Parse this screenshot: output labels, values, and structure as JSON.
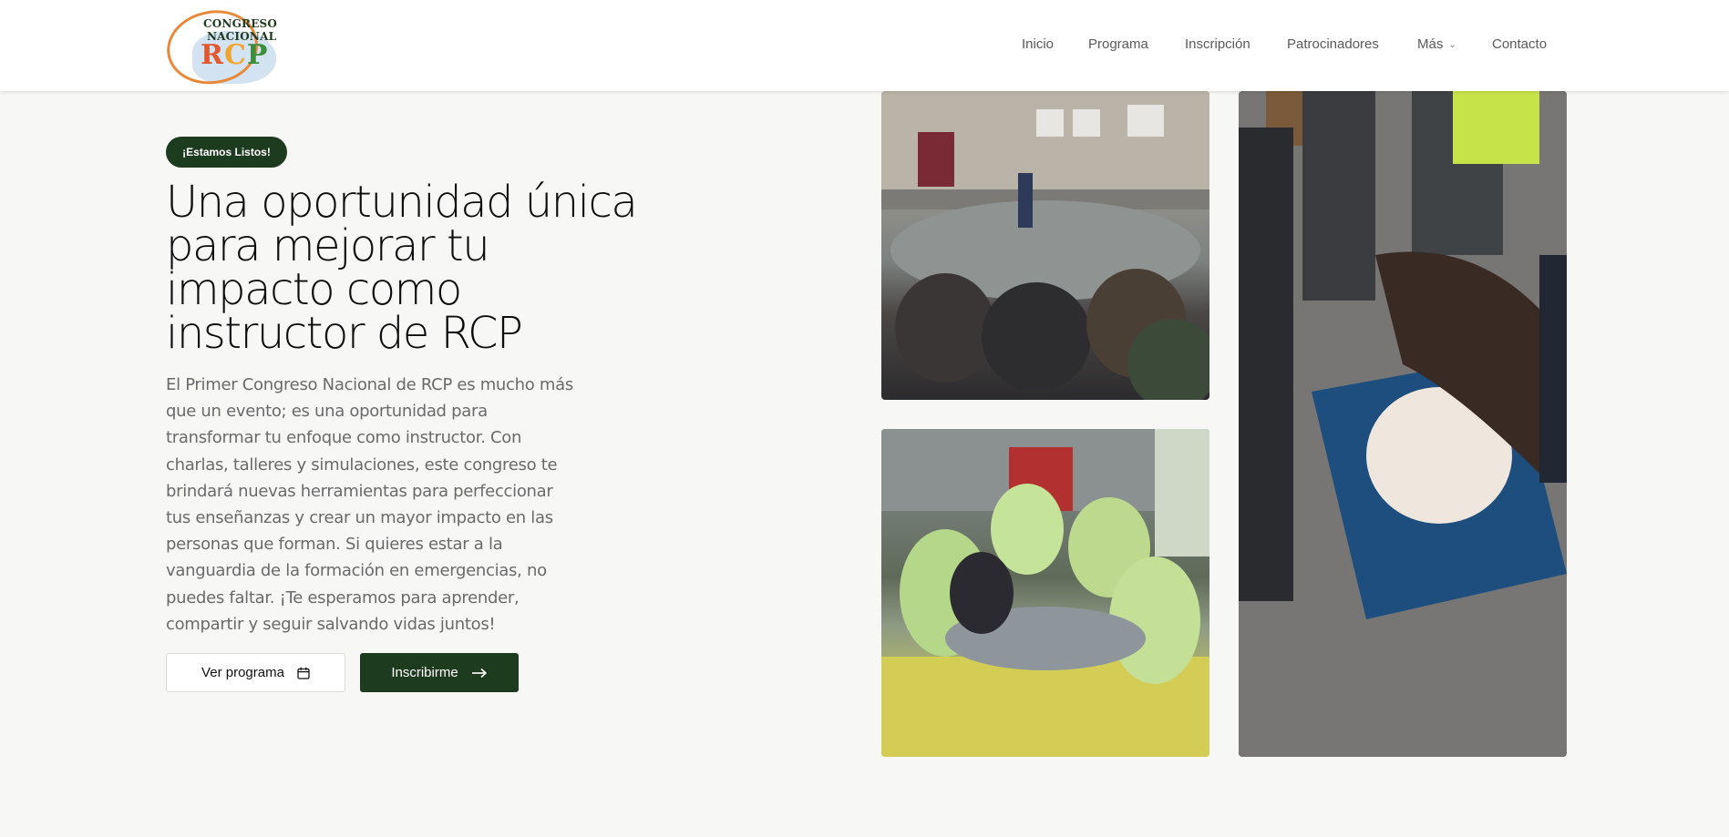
{
  "header": {
    "logo": {
      "line1": "CONGRESO",
      "line2": "NACIONAL",
      "line3_r": "R",
      "line3_c": "C",
      "line3_p": "P"
    },
    "nav": [
      {
        "label": "Inicio"
      },
      {
        "label": "Programa"
      },
      {
        "label": "Inscripción"
      },
      {
        "label": "Patrocinadores"
      },
      {
        "label": "Más"
      },
      {
        "label": "Contacto"
      }
    ]
  },
  "hero": {
    "badge": "¡Estamos Listos!",
    "title": "Una oportunidad única para mejorar tu impacto como instructor de RCP",
    "description": "El Primer Congreso Nacional de RCP es mucho más que un evento; es una oportunidad para transformar tu enfoque como instructor. Con charlas, talleres y simulaciones, este congreso te brindará nuevas herramientas para perfeccionar tus enseñanzas y crear un mayor impacto en las personas que forman. Si quieres estar a la vanguardia de la formación en emergencias, no puedes faltar. ¡Te esperamos para aprender, compartir y seguir salvando vidas juntos!",
    "buttons": {
      "secondary": "Ver programa",
      "primary": "Inscribirme"
    }
  },
  "icons": {
    "dropdown": "chevron-down-icon",
    "calendar": "calendar-icon",
    "arrow": "arrow-right-icon"
  },
  "colors": {
    "brand_dark_green": "#1d3b1f",
    "background": "#f7f7f6",
    "text_muted": "#6a6a6a"
  }
}
